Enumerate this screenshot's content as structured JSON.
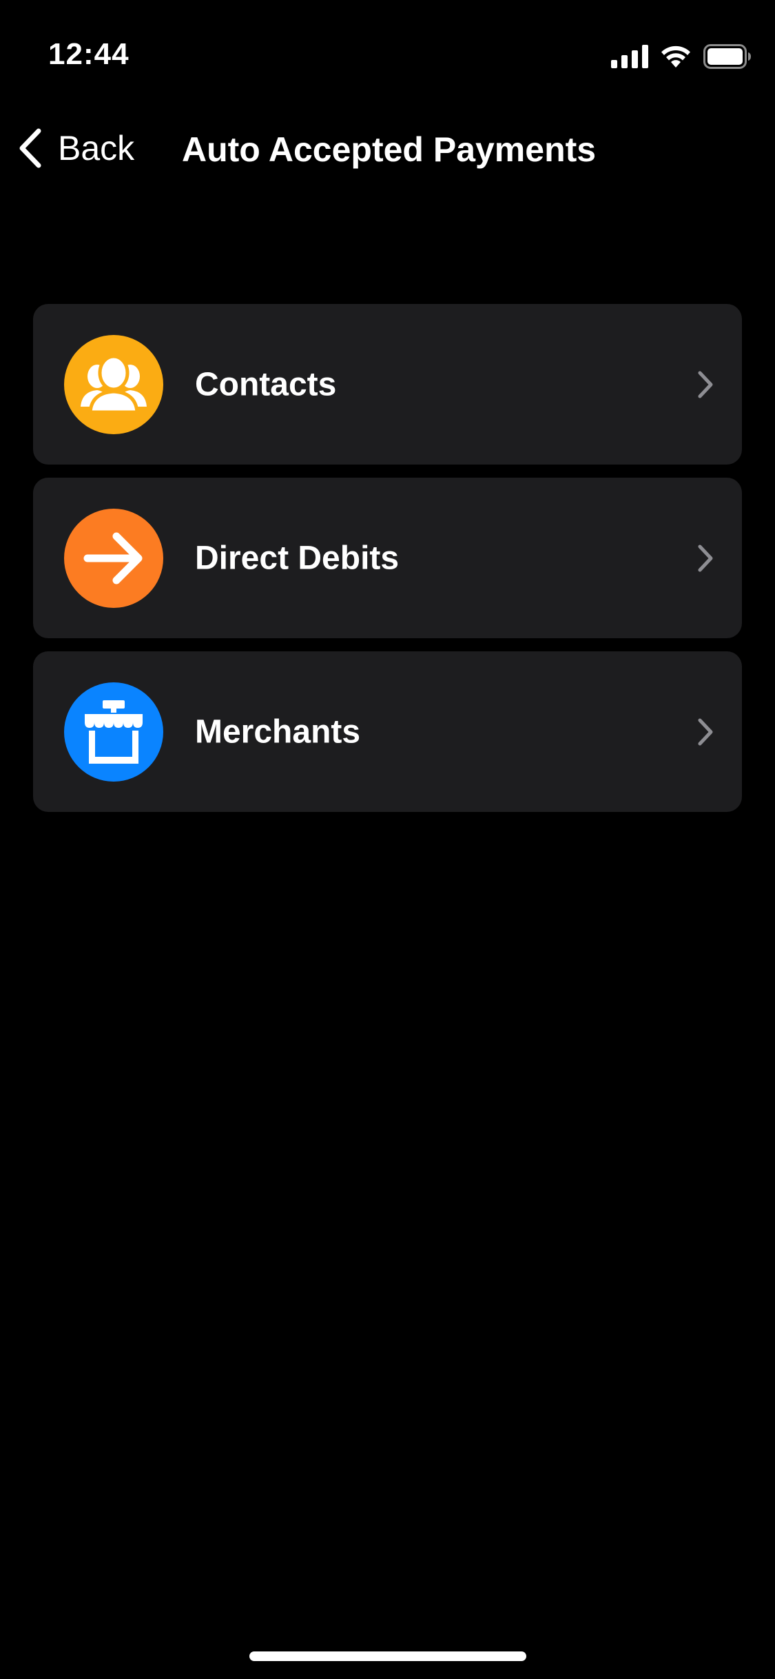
{
  "status_bar": {
    "time": "12:44",
    "icons": [
      "cellular-signal-icon",
      "wifi-icon",
      "battery-icon"
    ]
  },
  "nav": {
    "back_label": "Back",
    "title": "Auto Accepted Payments"
  },
  "list": {
    "items": [
      {
        "label": "Contacts",
        "icon": "contacts-icon",
        "color": "#fbac13"
      },
      {
        "label": "Direct Debits",
        "icon": "arrow-right-icon",
        "color": "#fc7c22"
      },
      {
        "label": "Merchants",
        "icon": "storefront-icon",
        "color": "#0a84ff"
      }
    ]
  },
  "colors": {
    "background": "#000000",
    "card": "#1d1d1f",
    "chevron": "#8e8e93",
    "text": "#ffffff"
  }
}
